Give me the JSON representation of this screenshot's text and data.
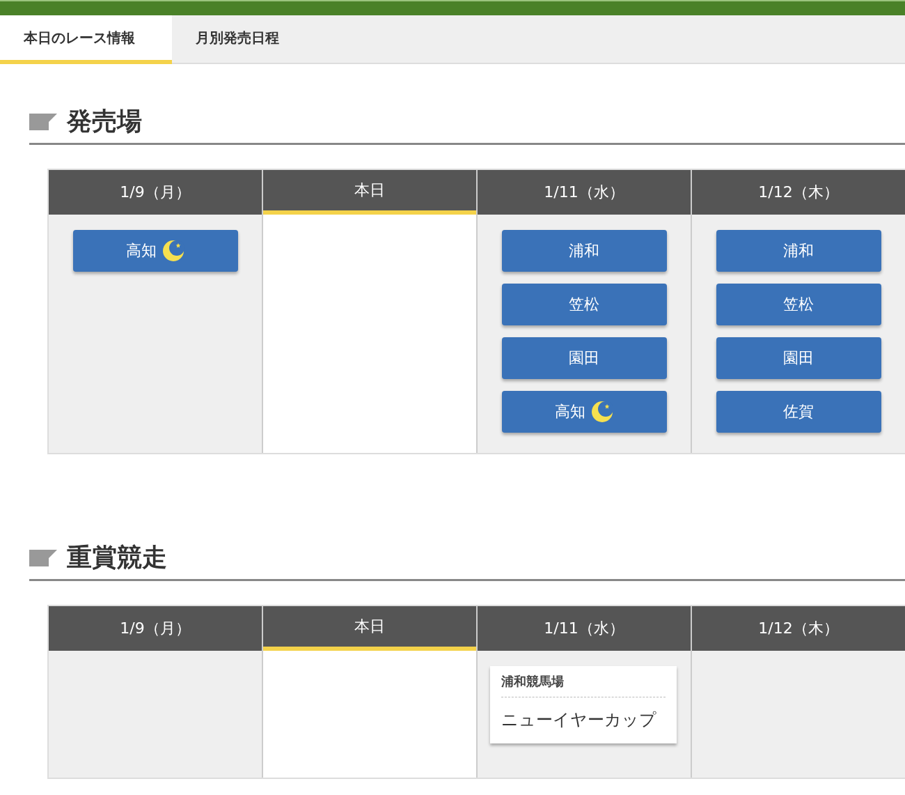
{
  "tabs": [
    {
      "label": "本日のレース情報",
      "selected": true
    },
    {
      "label": "月別発売日程",
      "selected": false
    }
  ],
  "venues_section": {
    "title": "発売場",
    "days": [
      {
        "label": "1/9（月）",
        "selected": false,
        "venues": [
          {
            "name": "高知",
            "night": true
          }
        ]
      },
      {
        "label": "本日",
        "selected": true
      },
      {
        "label": "1/11（水）",
        "selected": false,
        "venues": [
          {
            "name": "浦和",
            "night": false
          },
          {
            "name": "笠松",
            "night": false
          },
          {
            "name": "園田",
            "night": false
          },
          {
            "name": "高知",
            "night": true
          }
        ]
      },
      {
        "label": "1/12（木）",
        "selected": false,
        "venues": [
          {
            "name": "浦和",
            "night": false
          },
          {
            "name": "笠松",
            "night": false
          },
          {
            "name": "園田",
            "night": false
          },
          {
            "name": "佐賀",
            "night": false
          }
        ]
      }
    ]
  },
  "races_section": {
    "title": "重賞競走",
    "days": [
      {
        "label": "1/9（月）",
        "selected": false
      },
      {
        "label": "本日",
        "selected": true
      },
      {
        "label": "1/11（水）",
        "selected": false,
        "races": [
          {
            "track": "浦和競馬場",
            "name": "ニューイヤーカップ"
          }
        ]
      },
      {
        "label": "1/12（木）",
        "selected": false
      }
    ]
  }
}
